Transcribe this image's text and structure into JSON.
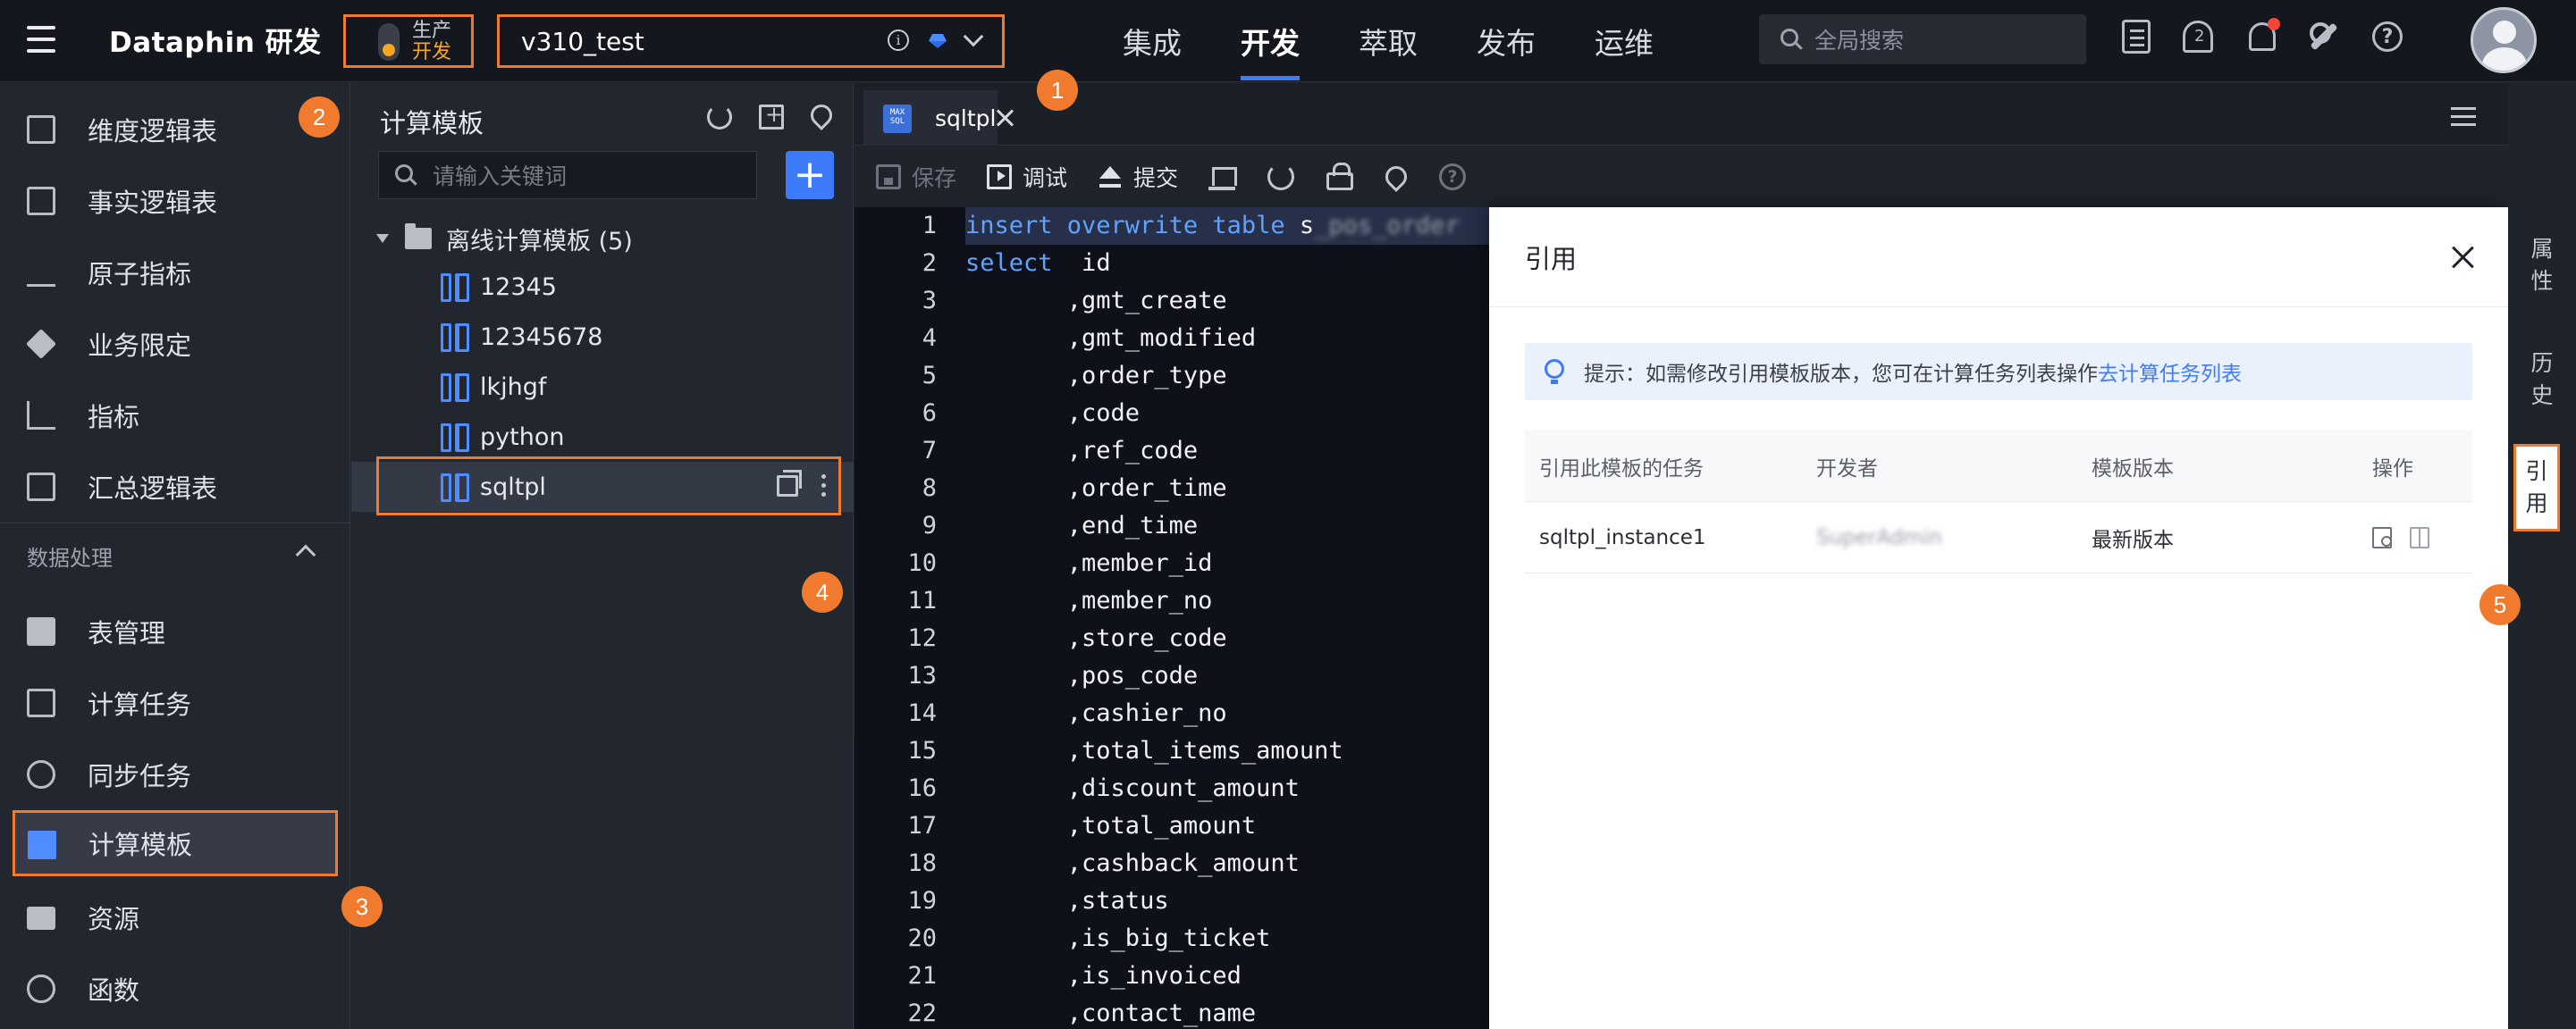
{
  "app": {
    "brand": "Dataphin 研发",
    "env": {
      "prod": "生产",
      "dev": "开发"
    },
    "project": "v310_test"
  },
  "topnav": [
    "集成",
    "开发",
    "萃取",
    "发布",
    "运维"
  ],
  "topnav_active": "开发",
  "search": {
    "placeholder": "全局搜索"
  },
  "sidebar": {
    "items_top": [
      "维度逻辑表",
      "事实逻辑表",
      "原子指标",
      "业务限定",
      "指标",
      "汇总逻辑表"
    ],
    "group": "数据处理",
    "items_bottom": [
      "表管理",
      "计算任务",
      "同步任务",
      "计算模板",
      "资源",
      "函数"
    ],
    "active": "计算模板"
  },
  "template_panel": {
    "title": "计算模板",
    "search_placeholder": "请输入关键词",
    "add_label": "+",
    "folder": "离线计算模板 (5)",
    "items": [
      "12345",
      "12345678",
      "lkjhgf",
      "python",
      "sqltpl"
    ],
    "selected": "sqltpl"
  },
  "tab": {
    "label": "sqltpl",
    "icon_text": "MAX SQL"
  },
  "toolbar": {
    "save": "保存",
    "debug": "调试",
    "submit": "提交"
  },
  "editor": {
    "lines": [
      {
        "n": "1",
        "kw": "insert overwrite table",
        "rest": " s",
        "masked": "_pos_order"
      },
      {
        "n": "2",
        "kw": "select",
        "rest": "  id"
      },
      {
        "n": "3",
        "rest": "       ,gmt_create"
      },
      {
        "n": "4",
        "rest": "       ,gmt_modified"
      },
      {
        "n": "5",
        "rest": "       ,order_type"
      },
      {
        "n": "6",
        "rest": "       ,code"
      },
      {
        "n": "7",
        "rest": "       ,ref_code"
      },
      {
        "n": "8",
        "rest": "       ,order_time"
      },
      {
        "n": "9",
        "rest": "       ,end_time"
      },
      {
        "n": "10",
        "rest": "       ,member_id"
      },
      {
        "n": "11",
        "rest": "       ,member_no"
      },
      {
        "n": "12",
        "rest": "       ,store_code"
      },
      {
        "n": "13",
        "rest": "       ,pos_code"
      },
      {
        "n": "14",
        "rest": "       ,cashier_no"
      },
      {
        "n": "15",
        "rest": "       ,total_items_amount"
      },
      {
        "n": "16",
        "rest": "       ,discount_amount"
      },
      {
        "n": "17",
        "rest": "       ,total_amount"
      },
      {
        "n": "18",
        "rest": "       ,cashback_amount"
      },
      {
        "n": "19",
        "rest": "       ,status"
      },
      {
        "n": "20",
        "rest": "       ,is_big_ticket"
      },
      {
        "n": "21",
        "rest": "       ,is_invoiced"
      },
      {
        "n": "22",
        "rest": "       ,contact_name"
      }
    ]
  },
  "drawer": {
    "title": "引用",
    "tip_text": "提示：如需修改引用模板版本，您可在计算任务列表操作",
    "tip_link": "去计算任务列表",
    "columns": [
      "引用此模板的任务",
      "开发者",
      "模板版本",
      "操作"
    ],
    "rows": [
      {
        "task": "sqltpl_instance1",
        "developer": "SuperAdmin",
        "version": "最新版本"
      }
    ]
  },
  "right_tabs": [
    "属\n性",
    "历\n史",
    "引\n用"
  ],
  "right_tab_active": "引用",
  "callouts": [
    "1",
    "2",
    "3",
    "4",
    "5"
  ],
  "colors": {
    "accent": "#3e7bfa",
    "highlight": "#f07b2f",
    "keyword": "#5fa2ff"
  }
}
